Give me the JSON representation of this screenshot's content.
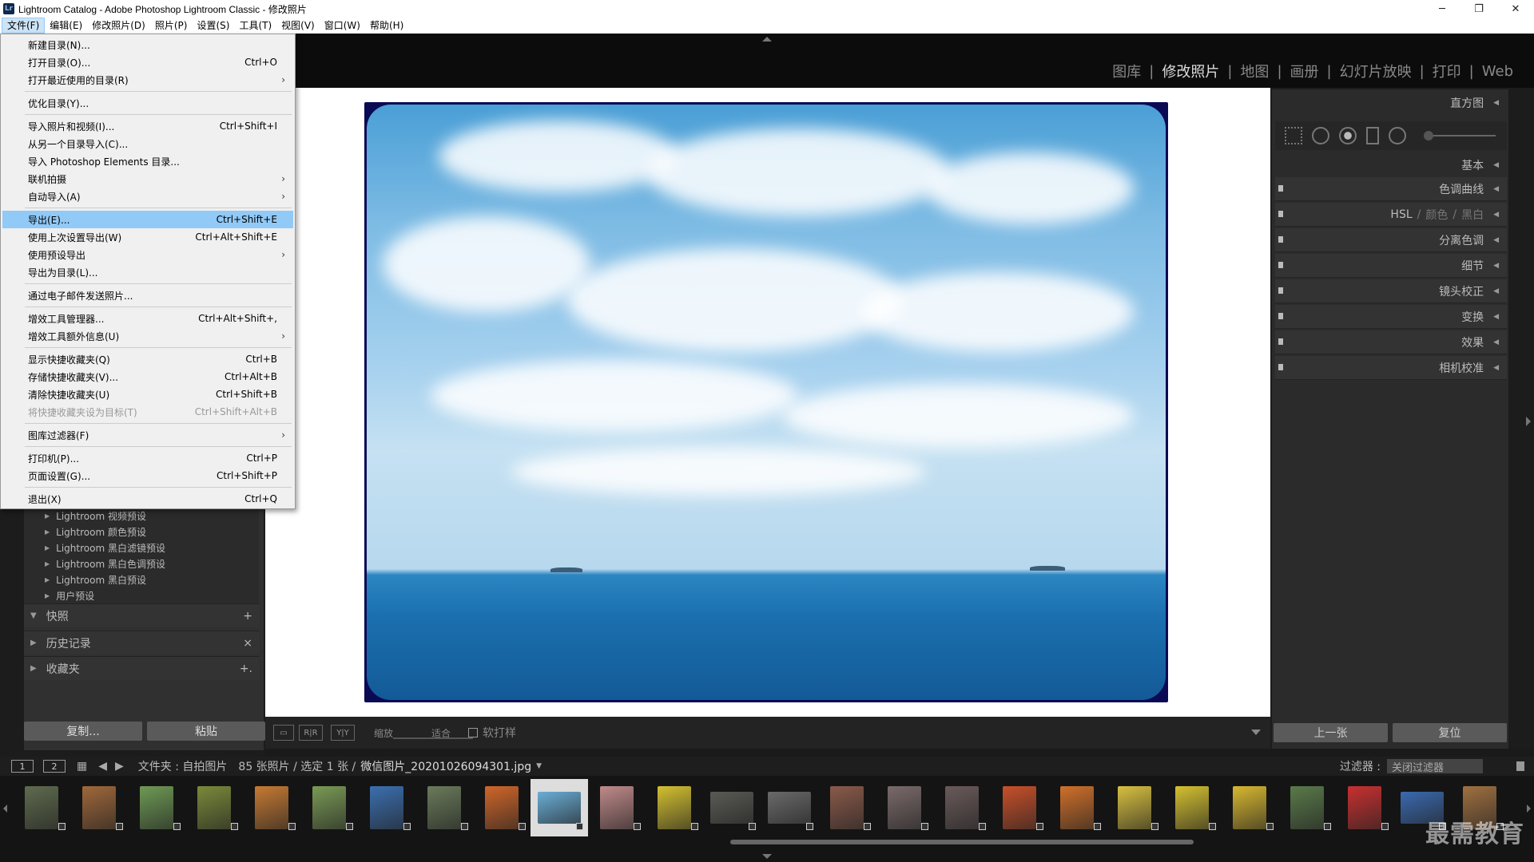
{
  "window": {
    "title": "Lightroom Catalog - Adobe Photoshop Lightroom Classic - 修改照片",
    "app_icon": "Lr",
    "controls": [
      "─",
      "❐",
      "✕"
    ]
  },
  "menubar": [
    "文件(F)",
    "编辑(E)",
    "修改照片(D)",
    "照片(P)",
    "设置(S)",
    "工具(T)",
    "视图(V)",
    "窗口(W)",
    "帮助(H)"
  ],
  "modules": [
    "图库",
    "修改照片",
    "地图",
    "画册",
    "幻灯片放映",
    "打印",
    "Web"
  ],
  "file_menu": {
    "items": [
      {
        "label": "新建目录(N)...",
        "shortcut": ""
      },
      {
        "label": "打开目录(O)...",
        "shortcut": "Ctrl+O"
      },
      {
        "label": "打开最近使用的目录(R)",
        "shortcut": "",
        "sub": "›"
      },
      {
        "label": "优化目录(Y)...",
        "shortcut": ""
      },
      {
        "label": "导入照片和视频(I)...",
        "shortcut": "Ctrl+Shift+I"
      },
      {
        "label": "从另一个目录导入(C)...",
        "shortcut": ""
      },
      {
        "label": "导入 Photoshop Elements 目录...",
        "shortcut": ""
      },
      {
        "label": "联机拍摄",
        "shortcut": "",
        "sub": "›"
      },
      {
        "label": "自动导入(A)",
        "shortcut": "",
        "sub": "›"
      },
      {
        "label": "导出(E)...",
        "shortcut": "Ctrl+Shift+E"
      },
      {
        "label": "使用上次设置导出(W)",
        "shortcut": "Ctrl+Alt+Shift+E"
      },
      {
        "label": "使用预设导出",
        "shortcut": "",
        "sub": "›"
      },
      {
        "label": "导出为目录(L)...",
        "shortcut": ""
      },
      {
        "label": "通过电子邮件发送照片...",
        "shortcut": ""
      },
      {
        "label": "增效工具管理器...",
        "shortcut": "Ctrl+Alt+Shift+,"
      },
      {
        "label": "增效工具额外信息(U)",
        "shortcut": "",
        "sub": "›"
      },
      {
        "label": "显示快捷收藏夹(Q)",
        "shortcut": "Ctrl+B"
      },
      {
        "label": "存储快捷收藏夹(V)...",
        "shortcut": "Ctrl+Alt+B"
      },
      {
        "label": "清除快捷收藏夹(U)",
        "shortcut": "Ctrl+Shift+B"
      },
      {
        "label": "将快捷收藏夹设为目标(T)",
        "shortcut": "Ctrl+Shift+Alt+B"
      },
      {
        "label": "图库过滤器(F)",
        "shortcut": "",
        "sub": "›"
      },
      {
        "label": "打印机(P)...",
        "shortcut": "Ctrl+P"
      },
      {
        "label": "页面设置(G)...",
        "shortcut": "Ctrl+Shift+P"
      },
      {
        "label": "退出(X)",
        "shortcut": "Ctrl+Q"
      }
    ]
  },
  "left_panel": {
    "presets": [
      "Lightroom 视频预设",
      "Lightroom 颜色预设",
      "Lightroom 黑白滤镜预设",
      "Lightroom 黑白色调预设",
      "Lightroom 黑白预设",
      "用户预设"
    ],
    "sections": [
      {
        "label": "快照",
        "action": "+"
      },
      {
        "label": "历史记录",
        "action": "×"
      },
      {
        "label": "收藏夹",
        "action": "+."
      }
    ],
    "copy_button": "复制...",
    "paste_button": "粘贴"
  },
  "toolbar": {
    "view_btn": "▭",
    "rr_btn": "R|R",
    "yy_btn": "Y|Y",
    "zoom_label": "缩放",
    "fit_label": "适合",
    "softproof_label": "软打样"
  },
  "right_panel": {
    "histogram": "直方图",
    "basic": "基本",
    "hsl_parts": [
      "HSL",
      "颜色",
      "黑白"
    ],
    "panels": [
      "色调曲线",
      "分离色调",
      "细节",
      "镜头校正",
      "变换",
      "效果",
      "相机校准"
    ],
    "prev_button": "上一张",
    "reset_button": "复位"
  },
  "filmstrip_bar": {
    "view1": "1",
    "view2": "2",
    "folder_label": "文件夹 : 自拍图片",
    "count_label": "85 张照片 / 选定 1 张 /",
    "filename": "微信图片_20201026094301.jpg",
    "filter_label": "过滤器 :",
    "filter_value": "关闭过滤器"
  },
  "filmstrip": {
    "thumb_colors": [
      "#5f6b4e",
      "#a0683a",
      "#6e9a55",
      "#7a8a3a",
      "#c77a33",
      "#7a9a55",
      "#3b6fb0",
      "#6a7a5a",
      "#d0662a",
      "#6aaed6",
      "#c08a8a",
      "#d4c030",
      "#5a5a55",
      "#6a6a6a",
      "#8a5a4a",
      "#7a6a6a",
      "#6a5a5a",
      "#c8502a",
      "#d0702a",
      "#d8c040",
      "#d4c030",
      "#d8b830",
      "#5a7a4a",
      "#c83030",
      "#3a6ab0",
      "#a07040"
    ],
    "selected_index": 9
  },
  "watermark": "最需教育"
}
